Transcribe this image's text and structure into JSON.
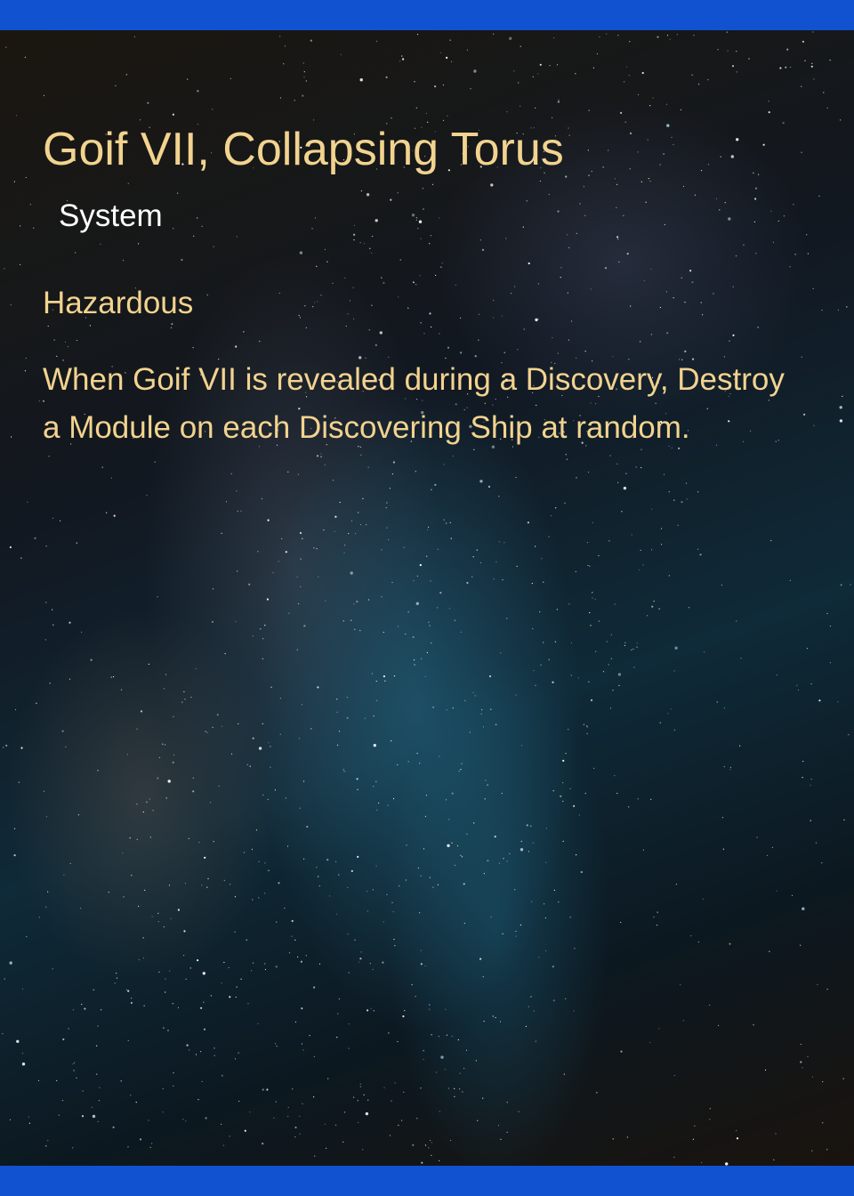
{
  "card": {
    "title": "Goif VII, Collapsing Torus",
    "type": "System",
    "keyword": "Hazardous",
    "ability": "When Goif VII is revealed during a Discovery, Destroy a Module on each Discovering Ship at random."
  },
  "colors": {
    "frame": "#1152d0",
    "title_text": "#f2d38f",
    "type_text": "#ffffff"
  },
  "background": {
    "icon": "starfield-milky-way-image"
  }
}
